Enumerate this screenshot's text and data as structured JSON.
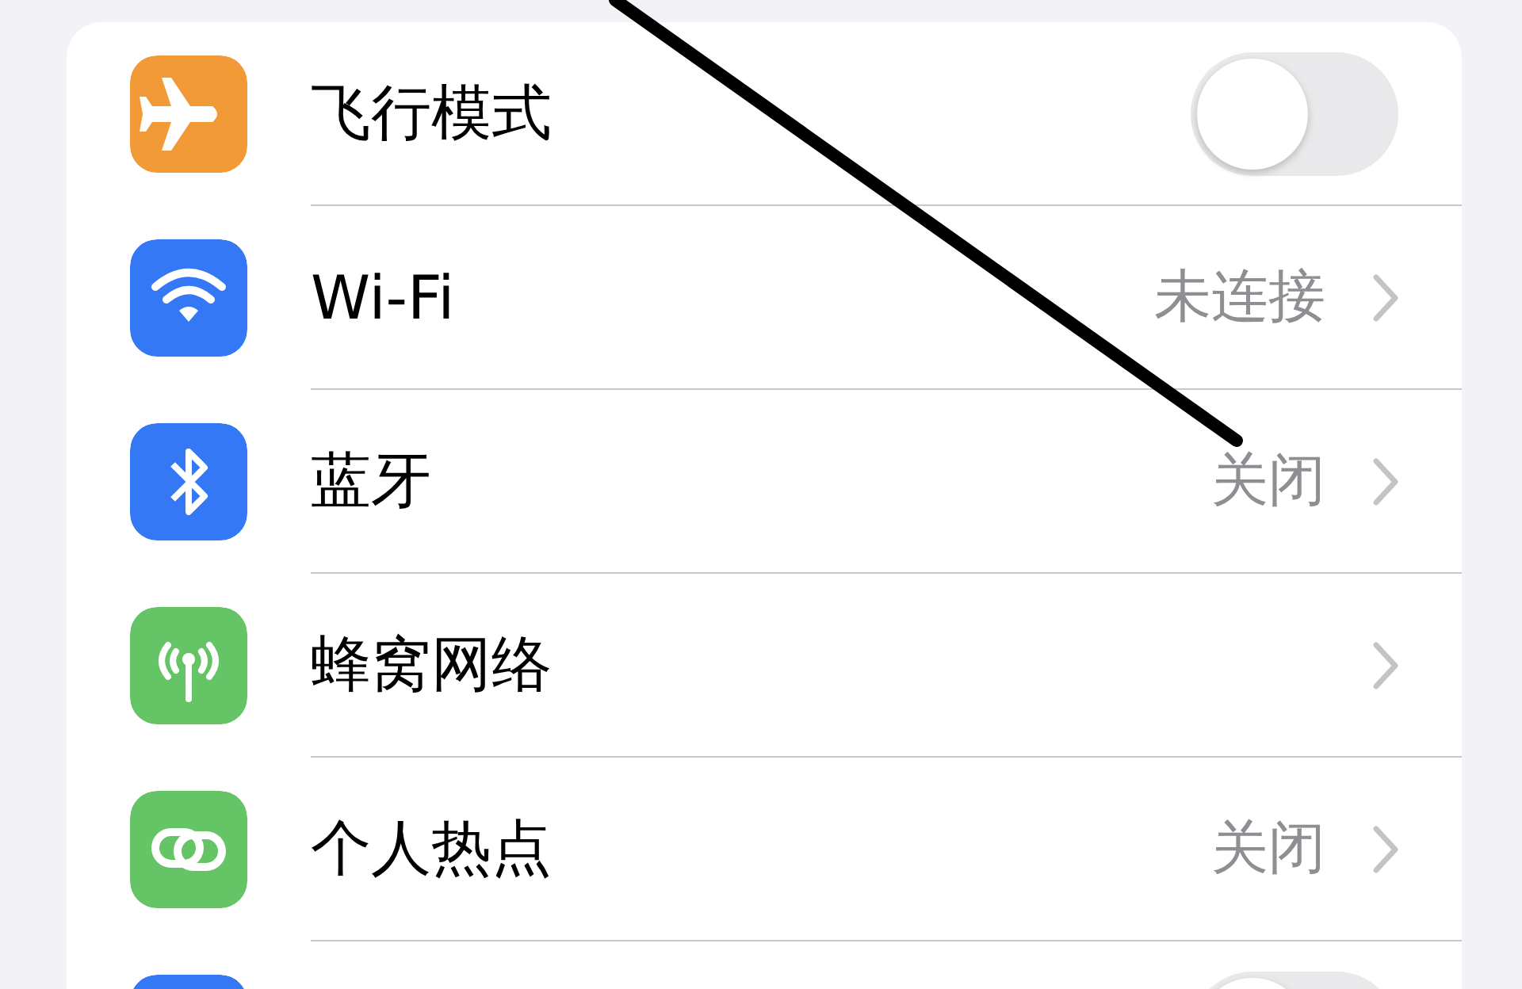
{
  "settings": [
    {
      "kind": "airplane",
      "color": "#f19a37",
      "label": "飞行模式",
      "on": false
    },
    {
      "kind": "wifi",
      "color": "#3478f6",
      "label": "Wi-Fi",
      "value": "未连接"
    },
    {
      "kind": "bluetooth",
      "color": "#3478f6",
      "label": "蓝牙",
      "value": "关闭"
    },
    {
      "kind": "cellular",
      "color": "#65c466",
      "label": "蜂窝网络"
    },
    {
      "kind": "hotspot",
      "color": "#65c466",
      "label": "个人热点",
      "value": "关闭"
    },
    {
      "kind": "generic",
      "color": "#3478f6",
      "on": false
    }
  ]
}
